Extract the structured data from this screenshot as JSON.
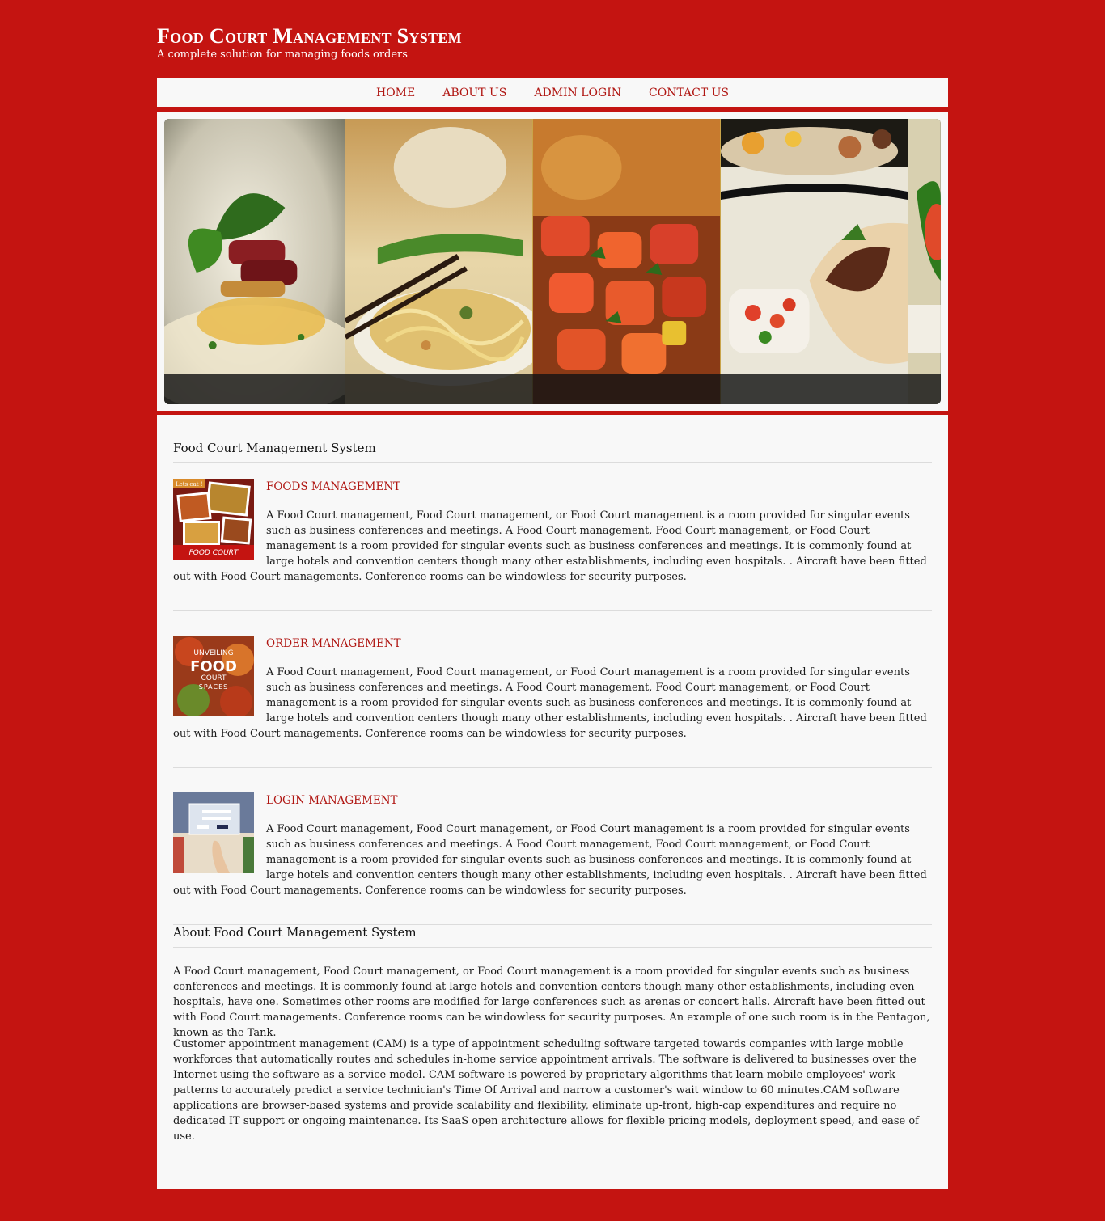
{
  "site": {
    "title": "Food Court Management System",
    "tagline": "A complete solution for managing foods orders"
  },
  "nav": {
    "items": [
      {
        "label": "HOME"
      },
      {
        "label": "ABOUT US"
      },
      {
        "label": "ADMIN LOGIN"
      },
      {
        "label": "CONTACT US"
      }
    ]
  },
  "main": {
    "title": "Food Court Management System",
    "features": [
      {
        "heading": "FOODS MANAGEMENT",
        "thumb_text_top": "Lets eat !",
        "thumb_text_bottom": "FOOD COURT",
        "text": "A Food Court management, Food Court management, or Food Court management is a room provided for singular events such as business conferences and meetings. A Food Court management, Food Court management, or Food Court management is a room provided for singular events such as business conferences and meetings. It is commonly found at large hotels and convention centers though many other establishments, including even hospitals. . Aircraft have been fitted out with Food Court managements. Conference rooms can be windowless for security purposes."
      },
      {
        "heading": "ORDER MANAGEMENT",
        "thumb_text_1": "UNVEILING",
        "thumb_text_2": "FOOD",
        "thumb_text_3": "COURT",
        "thumb_text_4": "SPACES",
        "text": "A Food Court management, Food Court management, or Food Court management is a room provided for singular events such as business conferences and meetings. A Food Court management, Food Court management, or Food Court management is a room provided for singular events such as business conferences and meetings. It is commonly found at large hotels and convention centers though many other establishments, including even hospitals. . Aircraft have been fitted out with Food Court managements. Conference rooms can be windowless for security purposes."
      },
      {
        "heading": "LOGIN MANAGEMENT",
        "text": "A Food Court management, Food Court management, or Food Court management is a room provided for singular events such as business conferences and meetings. A Food Court management, Food Court management, or Food Court management is a room provided for singular events such as business conferences and meetings. It is commonly found at large hotels and convention centers though many other establishments, including even hospitals. . Aircraft have been fitted out with Food Court managements. Conference rooms can be windowless for security purposes."
      }
    ]
  },
  "about": {
    "title": "About Food Court Management System",
    "paragraphs": [
      "A Food Court management, Food Court management, or Food Court management is a room provided for singular events such as business conferences and meetings. It is commonly found at large hotels and convention centers though many other establishments, including even hospitals, have one. Sometimes other rooms are modified for large conferences such as arenas or concert halls. Aircraft have been fitted out with Food Court managements. Conference rooms can be windowless for security purposes. An example of one such room is in the Pentagon, known as the Tank.",
      "Customer appointment management (CAM) is a type of appointment scheduling software targeted towards companies with large mobile workforces that automatically routes and schedules in-home service appointment arrivals. The software is delivered to businesses over the Internet using the software-as-a-service model. CAM software is powered by proprietary algorithms that learn mobile employees' work patterns to accurately predict a service technician's Time Of Arrival and narrow a customer's wait window to 60 minutes.CAM software applications are browser-based systems and provide scalability and flexibility, eliminate up-front, high-cap expenditures and require no dedicated IT support or ongoing maintenance. Its SaaS open architecture allows for flexible pricing models, deployment speed, and ease of use."
    ]
  },
  "colors": {
    "brand_red": "#c41411",
    "link_red": "#b01612",
    "panel_bg": "#f8f8f8"
  }
}
